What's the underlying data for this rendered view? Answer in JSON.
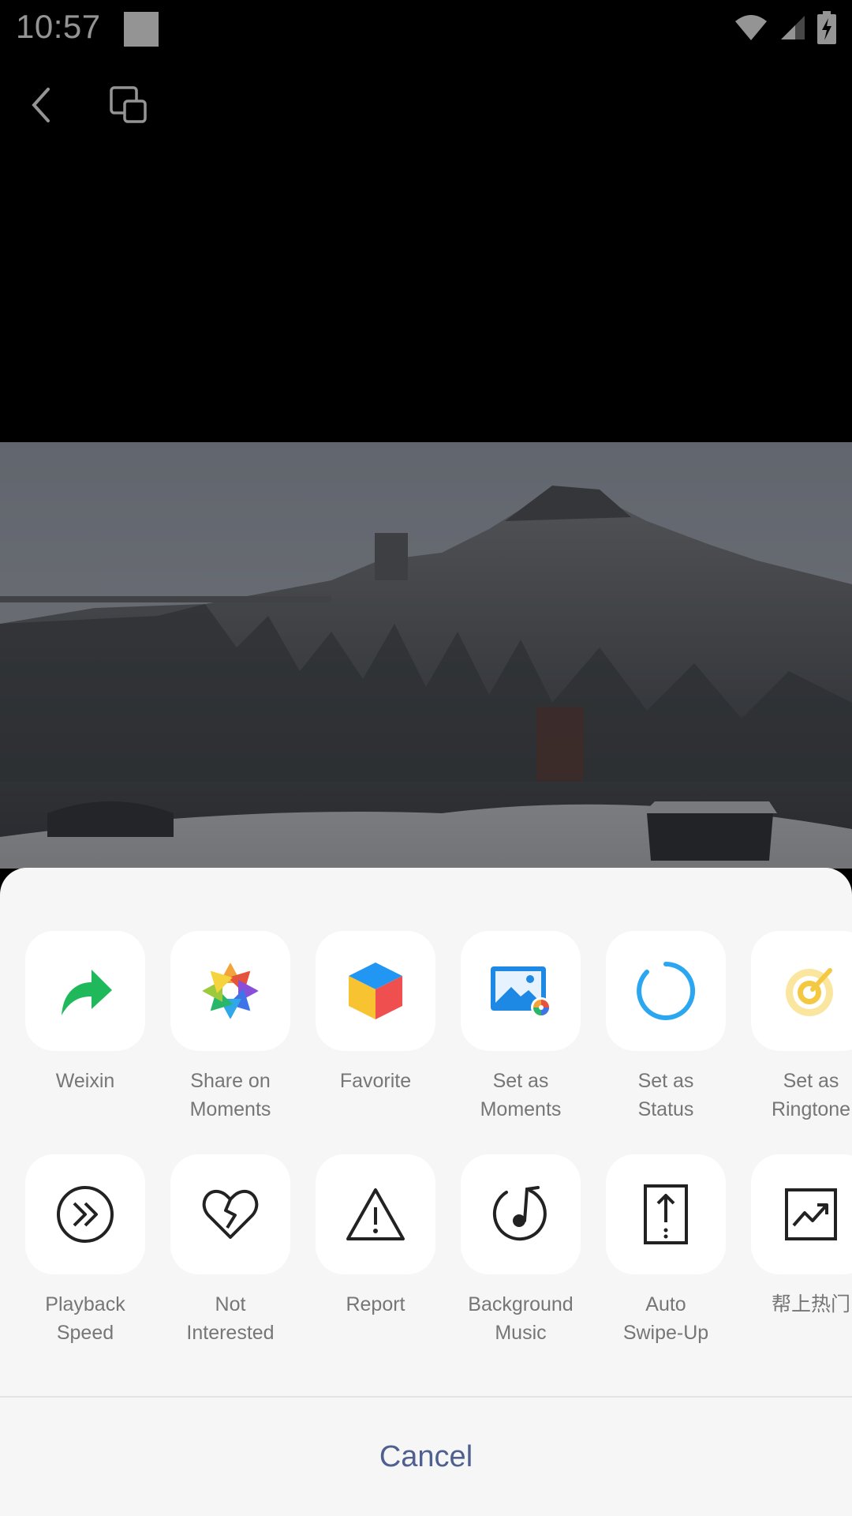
{
  "status_bar": {
    "time": "10:57",
    "icons": [
      "notification-square",
      "wifi-icon",
      "cell-signal-icon",
      "battery-charging-icon"
    ]
  },
  "top_bar": {
    "icons": [
      "back-icon",
      "floating-window-icon"
    ]
  },
  "share_sheet": {
    "row1": [
      {
        "label": "Weixin",
        "icon": "forward-arrow-icon",
        "color": "#1fb95c"
      },
      {
        "label": "Share on\nMoments",
        "icon": "moments-aperture-icon",
        "color": "#f2a33a"
      },
      {
        "label": "Favorite",
        "icon": "favorite-cube-icon",
        "color": "#f3c13a"
      },
      {
        "label": "Set as\nMoments",
        "icon": "picture-icon",
        "color": "#1e88e5"
      },
      {
        "label": "Set as\nStatus",
        "icon": "status-ring-icon",
        "color": "#2aa7f0"
      },
      {
        "label": "Set as\nRingtone",
        "icon": "ringtone-icon",
        "color": "#f5c842"
      }
    ],
    "row2": [
      {
        "label": "Playback\nSpeed",
        "icon": "fast-forward-circle-icon"
      },
      {
        "label": "Not\nInterested",
        "icon": "broken-heart-icon"
      },
      {
        "label": "Report",
        "icon": "warning-triangle-icon"
      },
      {
        "label": "Background\nMusic",
        "icon": "music-note-circle-icon"
      },
      {
        "label": "Auto\nSwipe-Up",
        "icon": "swipe-up-icon"
      },
      {
        "label": "帮上热门",
        "icon": "trending-chart-icon"
      }
    ],
    "cancel_label": "Cancel"
  },
  "colors": {
    "sheet_background": "#f6f6f6",
    "tile_background": "#ffffff",
    "label_text": "#767676",
    "cancel_text": "#4f5f8f"
  }
}
